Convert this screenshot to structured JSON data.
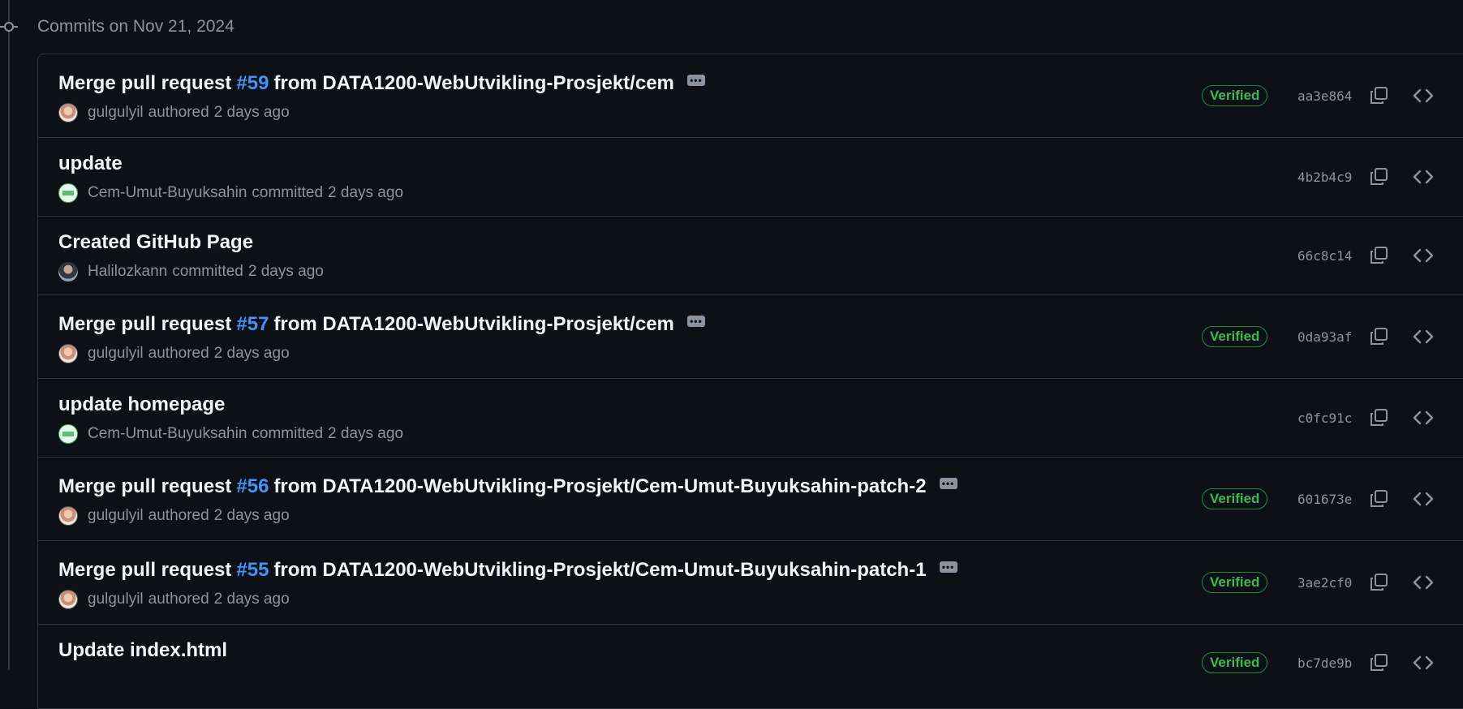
{
  "header": {
    "title": "Commits on Nov 21, 2024"
  },
  "colors": {
    "background": "#0d1117",
    "pr_link": "#4493f8",
    "verified": "#3fb950",
    "muted": "#8b949e"
  },
  "commits": [
    {
      "title_prefix": "Merge pull request",
      "pr_number": "#59",
      "title_suffix": "from DATA1200-WebUtvikling-Prosjekt/cem",
      "author": "gulgulyil",
      "verb": "authored",
      "time": "2 days ago",
      "avatar": "gulgulyil-avatar",
      "verified": "Verified",
      "sha": "aa3e864"
    },
    {
      "title": "update",
      "author": "Cem-Umut-Buyuksahin",
      "verb": "committed",
      "time": "2 days ago",
      "avatar": "cem-avatar",
      "sha": "4b2b4c9"
    },
    {
      "title": "Created GitHub Page",
      "author": "Halilozkann",
      "verb": "committed",
      "time": "2 days ago",
      "avatar": "halilozkann-avatar",
      "sha": "66c8c14"
    },
    {
      "title_prefix": "Merge pull request",
      "pr_number": "#57",
      "title_suffix": "from DATA1200-WebUtvikling-Prosjekt/cem",
      "author": "gulgulyil",
      "verb": "authored",
      "time": "2 days ago",
      "avatar": "gulgulyil-avatar",
      "verified": "Verified",
      "sha": "0da93af"
    },
    {
      "title": "update homepage",
      "author": "Cem-Umut-Buyuksahin",
      "verb": "committed",
      "time": "2 days ago",
      "avatar": "cem-avatar",
      "sha": "c0fc91c"
    },
    {
      "title_prefix": "Merge pull request",
      "pr_number": "#56",
      "title_suffix": "from DATA1200-WebUtvikling-Prosjekt/Cem-Umut-Buyuksahin-patch-2",
      "author": "gulgulyil",
      "verb": "authored",
      "time": "2 days ago",
      "avatar": "gulgulyil-avatar",
      "verified": "Verified",
      "sha": "601673e"
    },
    {
      "title_prefix": "Merge pull request",
      "pr_number": "#55",
      "title_suffix": "from DATA1200-WebUtvikling-Prosjekt/Cem-Umut-Buyuksahin-patch-1",
      "author": "gulgulyil",
      "verb": "authored",
      "time": "2 days ago",
      "avatar": "gulgulyil-avatar",
      "verified": "Verified",
      "sha": "3ae2cf0"
    },
    {
      "title": "Update index.html",
      "verified": "Verified",
      "sha": "bc7de9b"
    }
  ],
  "icons": {
    "commit_node": "git-commit-icon",
    "ellipsis": "ellipsis-icon",
    "copy": "copy-icon",
    "browse": "code-icon"
  }
}
